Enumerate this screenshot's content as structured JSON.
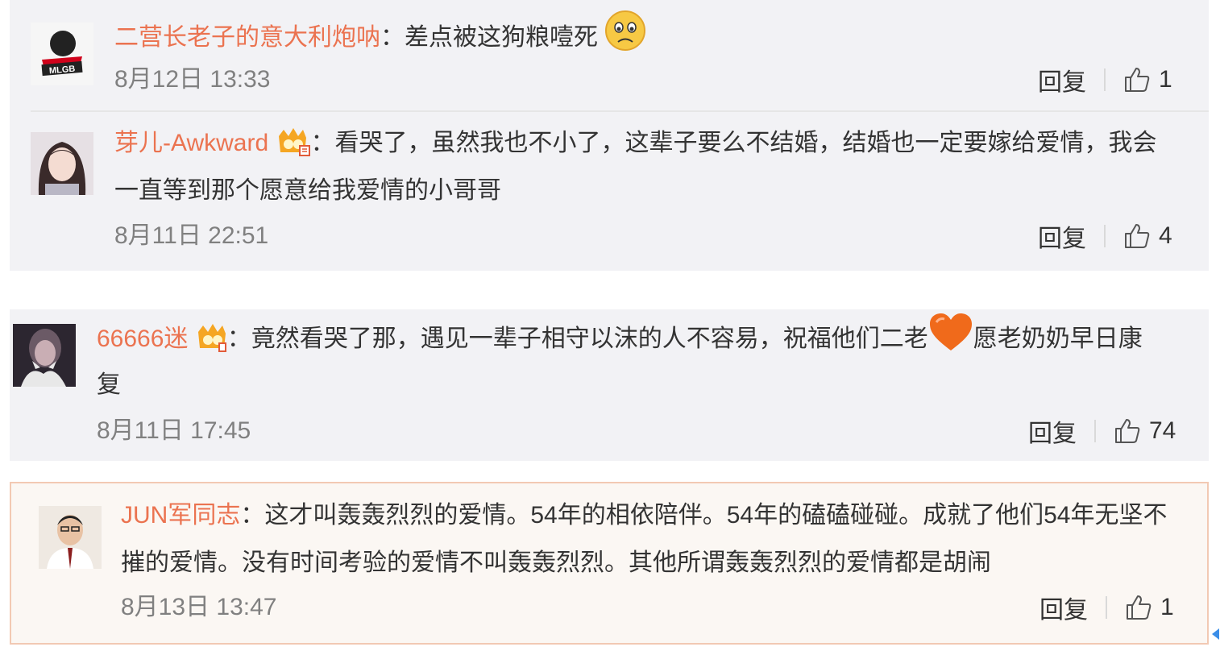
{
  "comments": [
    {
      "user": "二营长老子的意大利炮呐",
      "lines": [
        "：差点被这狗粮噎死"
      ],
      "time": "8月12日 13:33",
      "reply": "回复",
      "likes": "1",
      "avatar_text": "MLGB",
      "emoji": "sad-face-emoji"
    },
    {
      "user": "芽儿-Awkward",
      "lines": [
        "：看哭了，虽然我也不小了，这辈子要么不结婚，结婚也一定要嫁给爱情，我会",
        "一直等到那个愿意给我爱情的小哥哥"
      ],
      "time": "8月11日 22:51",
      "reply": "回复",
      "likes": "4",
      "badge": "vip-crown-badge"
    },
    {
      "user": "66666迷",
      "lines": [
        "：竟然看哭了那，遇见一辈子相守以沫的人不容易，祝福他们二老",
        "愿老奶奶早日康",
        "复"
      ],
      "time": "8月11日 17:45",
      "reply": "回复",
      "likes": "74",
      "badge": "vip-crown-badge",
      "emoji": "heart-emoji"
    },
    {
      "user": "JUN军同志",
      "lines": [
        "：这才叫轰轰烈烈的爱情。54年的相依陪伴。54年的磕磕碰碰。成就了他们54年无坚不",
        "摧的爱情。没有时间考验的爱情不叫轰轰烈烈。其他所谓轰轰烈烈的爱情都是胡闹"
      ],
      "time": "8月13日 13:47",
      "reply": "回复",
      "likes": "1"
    }
  ],
  "colors": {
    "username": "#eb7350",
    "panel": "#f2f2f5",
    "highlight_border": "#f2c9b3",
    "highlight_bg": "#fbf7f3"
  }
}
